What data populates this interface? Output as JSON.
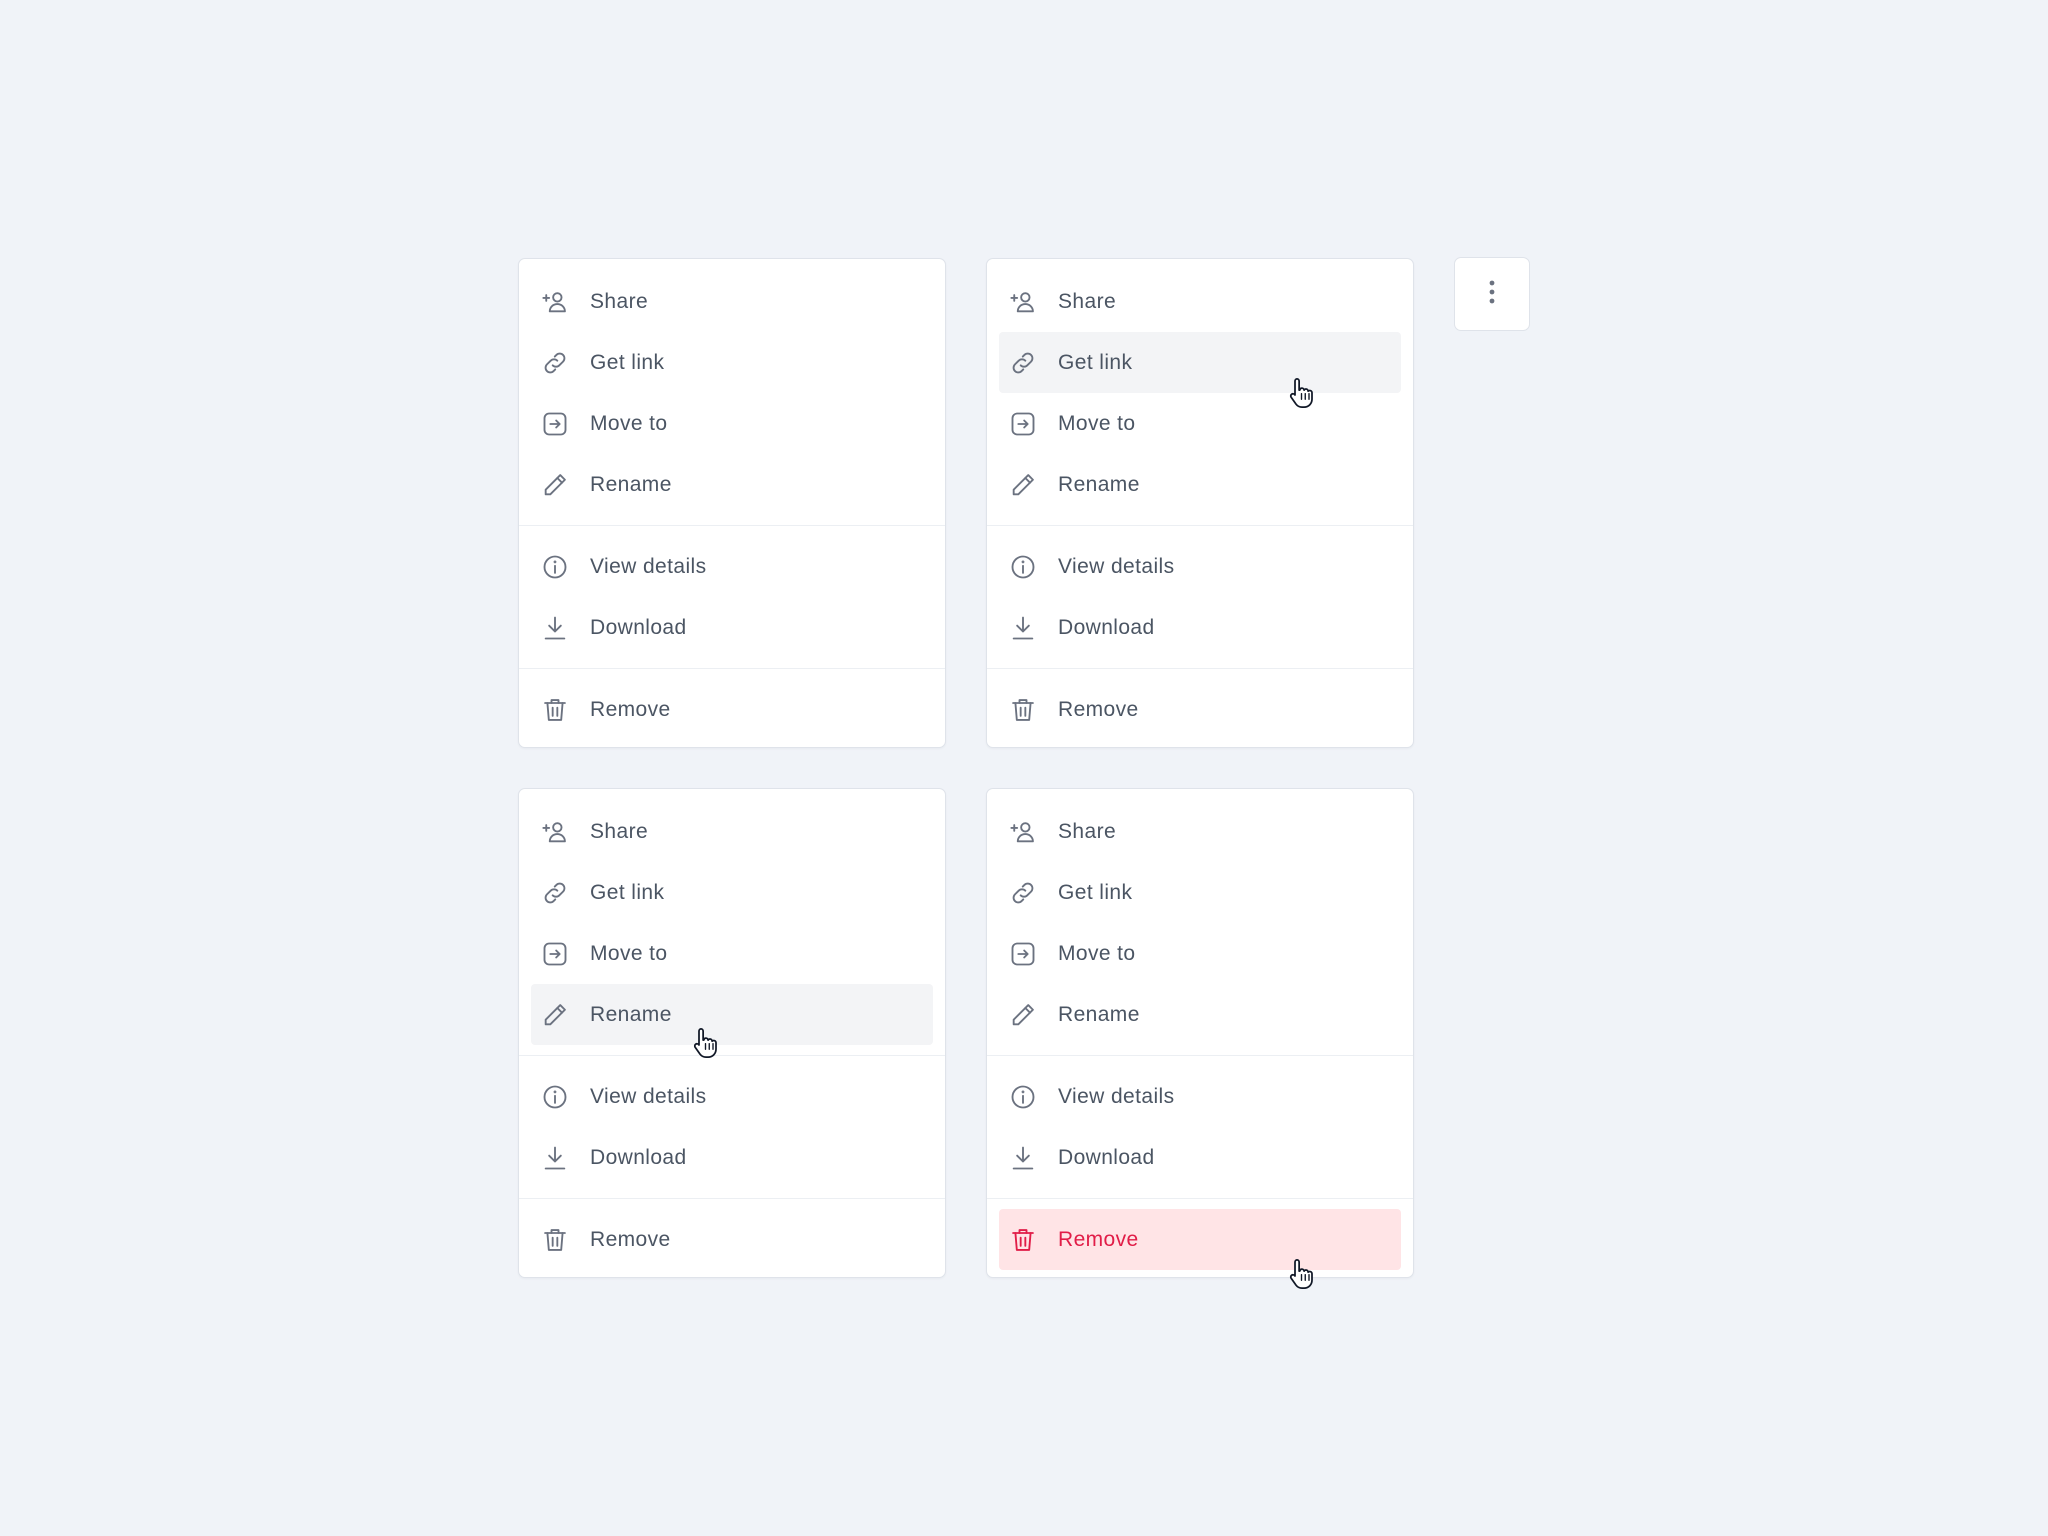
{
  "menus": [
    {
      "state": "default",
      "items": {
        "share": "Share",
        "get_link": "Get link",
        "move_to": "Move to",
        "rename": "Rename",
        "view_details": "View details",
        "download": "Download",
        "remove": "Remove"
      }
    },
    {
      "state": "hover-get-link",
      "items": {
        "share": "Share",
        "get_link": "Get link",
        "move_to": "Move to",
        "rename": "Rename",
        "view_details": "View details",
        "download": "Download",
        "remove": "Remove"
      }
    },
    {
      "state": "hover-rename",
      "items": {
        "share": "Share",
        "get_link": "Get link",
        "move_to": "Move to",
        "rename": "Rename",
        "view_details": "View details",
        "download": "Download",
        "remove": "Remove"
      }
    },
    {
      "state": "hover-remove",
      "items": {
        "share": "Share",
        "get_link": "Get link",
        "move_to": "Move to",
        "rename": "Rename",
        "view_details": "View details",
        "download": "Download",
        "remove": "Remove"
      }
    }
  ],
  "icons": {
    "share": "user-plus-icon",
    "get_link": "link-icon",
    "move_to": "arrow-right-square-icon",
    "rename": "pencil-icon",
    "view_details": "info-circle-icon",
    "download": "download-icon",
    "remove": "trash-icon",
    "more": "more-vertical-icon",
    "cursor": "hand-pointer-cursor-icon"
  },
  "colors": {
    "background": "#f0f3f8",
    "menu_bg": "#ffffff",
    "border": "#dfe3ea",
    "text": "#4b5563",
    "icon": "#6b7280",
    "hover_bg": "#f3f4f6",
    "danger_bg": "#ffe4e6",
    "danger_text": "#e11d48"
  }
}
